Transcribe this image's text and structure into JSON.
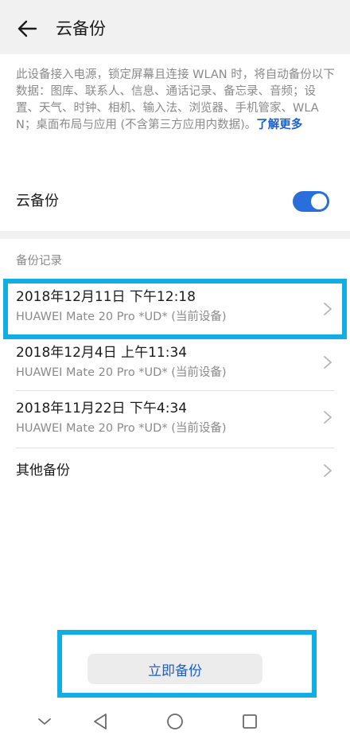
{
  "header": {
    "title": "云备份",
    "back_icon": "back-arrow-icon"
  },
  "description": {
    "text": "此设备接入电源，锁定屏幕且连接 WLAN 时，将自动备份以下数据：图库、联系人、信息、通话记录、备忘录、音频；设置、天气、时钟、相机、输入法、浏览器、手机管家、WLAN；桌面布局与应用 (不含第三方应用内数据)。",
    "learn_more": "了解更多"
  },
  "cloud_backup_toggle": {
    "label": "云备份",
    "enabled": true
  },
  "records": {
    "section_title": "备份记录",
    "items": [
      {
        "title": "2018年12月11日 下午12:18",
        "subtitle": "HUAWEI Mate 20 Pro *UD* (当前设备)",
        "highlighted": true
      },
      {
        "title": "2018年12月4日 上午11:34",
        "subtitle": "HUAWEI Mate 20 Pro *UD* (当前设备)",
        "highlighted": false
      },
      {
        "title": "2018年11月22日 下午4:34",
        "subtitle": "HUAWEI Mate 20 Pro *UD* (当前设备)",
        "highlighted": false
      }
    ],
    "other_backups": "其他备份"
  },
  "backup_now_button": {
    "label": "立即备份"
  },
  "colors": {
    "accent": "#2a6edb",
    "highlight": "#11aee4"
  },
  "navbar": {
    "icons": [
      "collapse-chevron-icon",
      "back-triangle-icon",
      "home-circle-icon",
      "recents-square-icon"
    ]
  }
}
